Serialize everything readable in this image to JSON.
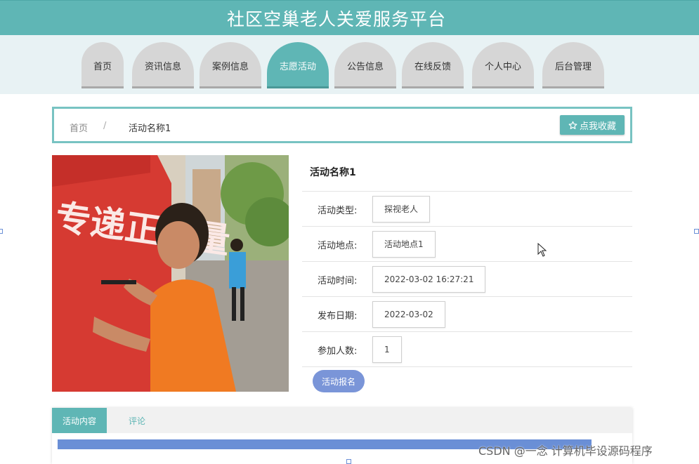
{
  "header": {
    "title": "社区空巢老人关爱服务平台"
  },
  "nav": {
    "items": [
      {
        "label": "首页"
      },
      {
        "label": "资讯信息"
      },
      {
        "label": "案例信息"
      },
      {
        "label": "志愿活动",
        "active": true
      },
      {
        "label": "公告信息"
      },
      {
        "label": "在线反馈"
      },
      {
        "label": "个人中心"
      },
      {
        "label": "后台管理"
      }
    ]
  },
  "breadcrumb": {
    "home": "首页",
    "separator": "/",
    "current": "活动名称1"
  },
  "favorite": {
    "icon": "star-outline-icon",
    "label": "点我收藏"
  },
  "activity": {
    "name": "活动名称1",
    "fields": [
      {
        "label": "活动类型:",
        "value": "探视老人"
      },
      {
        "label": "活动地点:",
        "value": "活动地点1"
      },
      {
        "label": "活动时间:",
        "value": "2022-03-02 16:27:21"
      },
      {
        "label": "发布日期:",
        "value": "2022-03-02"
      },
      {
        "label": "参加人数:",
        "value": "1"
      }
    ],
    "join_label": "活动报名"
  },
  "photo": {
    "banner_text": "专递正能量"
  },
  "tabs": {
    "content_label": "活动内容",
    "comment_label": "评论"
  },
  "watermark": "CSDN @一念 计算机毕设源码程序",
  "colors": {
    "primary": "#5fb6b5",
    "accent_button": "#7a95d8",
    "nav_inactive": "#d6d6d6"
  }
}
